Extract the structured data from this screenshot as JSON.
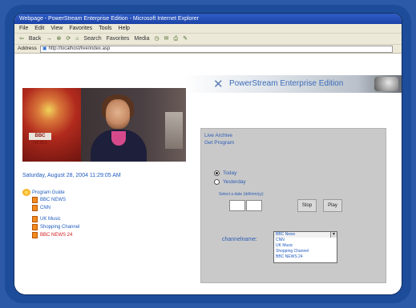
{
  "window": {
    "title": "Webpage - PowerStream Enterprise Edition - Microsoft Internet Explorer"
  },
  "menu": [
    "File",
    "Edit",
    "View",
    "Favorites",
    "Tools",
    "Help"
  ],
  "toolbar": {
    "back": "Back",
    "forward": "→",
    "search": "Search",
    "favorites": "Favorites",
    "media": "Media"
  },
  "address": {
    "label": "Address",
    "value": "http://localhost/live/index.asp"
  },
  "banner": {
    "brand": "PowerStream Enterprise Edition"
  },
  "video": {
    "channel_logo": "BBC NEWS"
  },
  "datetime": "Saturday, August 28, 2004 11:29:05 AM",
  "tree": {
    "root": "Program Guide",
    "items": [
      {
        "label": "BBC NEWS",
        "style": "blue"
      },
      {
        "label": "CNN",
        "style": "blue"
      },
      {
        "label": "UK Music",
        "style": "blue"
      },
      {
        "label": "Shopping Channel",
        "style": "blue"
      },
      {
        "label": "BBC NEWS 24",
        "style": "red"
      }
    ]
  },
  "panel": {
    "title_line1": "Live Archive",
    "title_line2": "Get Program",
    "radio_today": "Today",
    "radio_yesterday": "Yesterday",
    "date_hint": "Select a date (dd/mm/yy)",
    "btn_stop": "Stop",
    "btn_play": "Play",
    "channel_label": "channelname:",
    "channels": [
      "BBC News",
      "CNN",
      "UK Music",
      "Shopping Channel",
      "BBC NEWS 24"
    ],
    "selected_channel": "BBC News"
  },
  "colors": {
    "frame": "#1d4c9a",
    "link": "#1f5bbf",
    "panel": "#c9c9c9"
  }
}
